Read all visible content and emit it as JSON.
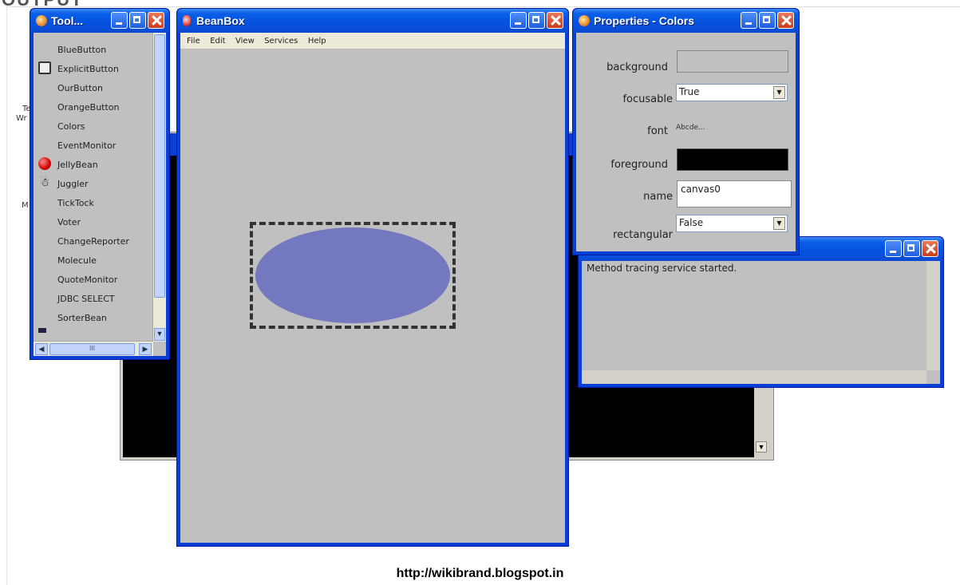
{
  "page": {
    "heading_fragment": "OUTPUT",
    "footer_url": "http://wikibrand.blogspot.in"
  },
  "toolbox": {
    "title": "Tool...",
    "items": [
      "BlueButton",
      "ExplicitButton",
      "OurButton",
      "OrangeButton",
      "Colors",
      "EventMonitor",
      "JellyBean",
      "Juggler",
      "TickTock",
      "Voter",
      "ChangeReporter",
      "Molecule",
      "QuoteMonitor",
      "JDBC SELECT",
      "SorterBean"
    ],
    "scroll_label": "III"
  },
  "beanbox": {
    "title": "BeanBox",
    "menus": [
      "File",
      "Edit",
      "View",
      "Services",
      "Help"
    ],
    "bean_color": "#7479bf"
  },
  "properties": {
    "title": "Properties - Colors",
    "fields": [
      {
        "label": "background",
        "value": ""
      },
      {
        "label": "focusable",
        "value": "True"
      },
      {
        "label": "font",
        "value": "Abcde..."
      },
      {
        "label": "foreground",
        "value": ""
      },
      {
        "label": "name",
        "value": "canvas0"
      },
      {
        "label": "rectangular",
        "value": "False"
      }
    ]
  },
  "trace": {
    "message": "Method tracing service started."
  },
  "bg_fragments": [
    "Te",
    "Wr",
    "M"
  ]
}
